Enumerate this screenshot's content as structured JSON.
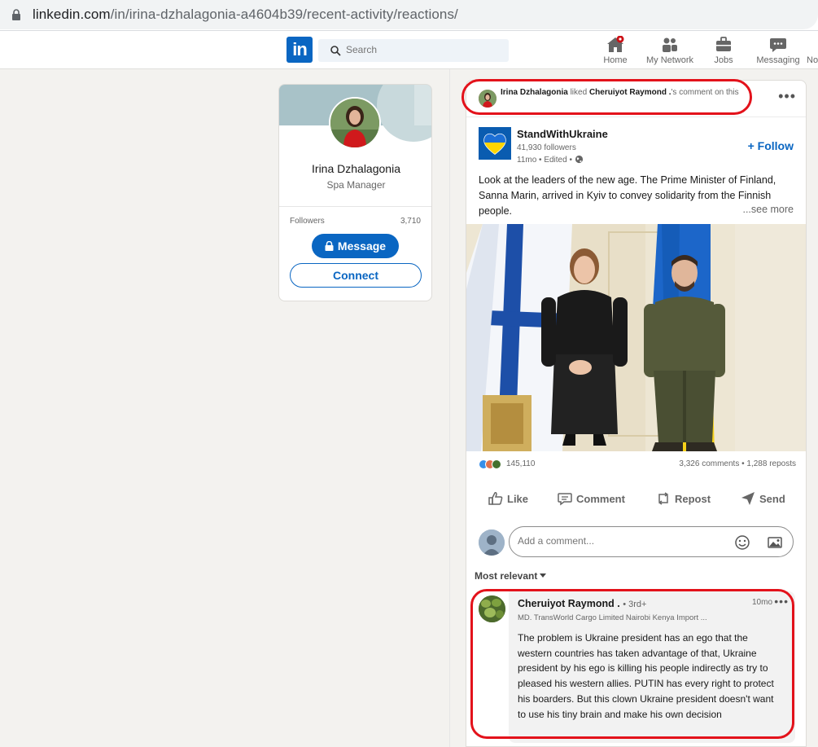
{
  "browser": {
    "url_host": "linkedin.com",
    "url_path": "/in/irina-dzhalagonia-a4604b39/recent-activity/reactions/"
  },
  "nav": {
    "search_placeholder": "Search",
    "items": [
      {
        "label": "Home"
      },
      {
        "label": "My Network"
      },
      {
        "label": "Jobs"
      },
      {
        "label": "Messaging"
      },
      {
        "label": "No"
      }
    ]
  },
  "profile": {
    "name": "Irina Dzhalagonia",
    "title": "Spa Manager",
    "followers_label": "Followers",
    "followers_count": "3,710",
    "message_button": "Message",
    "connect_button": "Connect"
  },
  "post": {
    "activity": {
      "actor": "Irina Dzhalagonia",
      "verb": "liked",
      "target": "Cheruiyot Raymond .",
      "suffix": "'s comment on this"
    },
    "org": {
      "name": "StandWithUkraine",
      "followers": "41,930 followers",
      "meta": "11mo • Edited •"
    },
    "follow_label": "+ Follow",
    "text": "Look at the leaders of the new age. The Prime Minister of Finland, Sanna Marin, arrived in Kyiv to convey solidarity from the Finnish people.",
    "see_more": "...see more",
    "reactions_count": "145,110",
    "comments_reposts": "3,326 comments • 1,288 reposts",
    "actions": [
      {
        "label": "Like"
      },
      {
        "label": "Comment"
      },
      {
        "label": "Repost"
      },
      {
        "label": "Send"
      }
    ],
    "comment_placeholder": "Add a comment...",
    "sort_label": "Most relevant"
  },
  "comment": {
    "author": "Cheruiyot Raymond .",
    "degree": "• 3rd+",
    "time": "10mo",
    "headline": "MD. TransWorld Cargo Limited Nairobi Kenya Import ...",
    "body": "The problem is Ukraine president has an ego that the western countries has taken advantage of that, Ukraine president by his ego is killing his people indirectly as try to pleased his western allies. PUTIN has every right to protect his boarders. But this clown Ukraine president doesn't want to use his tiny brain and make his own decision"
  },
  "colors": {
    "brand": "#0a66c2",
    "highlight": "#e3121b",
    "background": "#f3f2ef"
  }
}
